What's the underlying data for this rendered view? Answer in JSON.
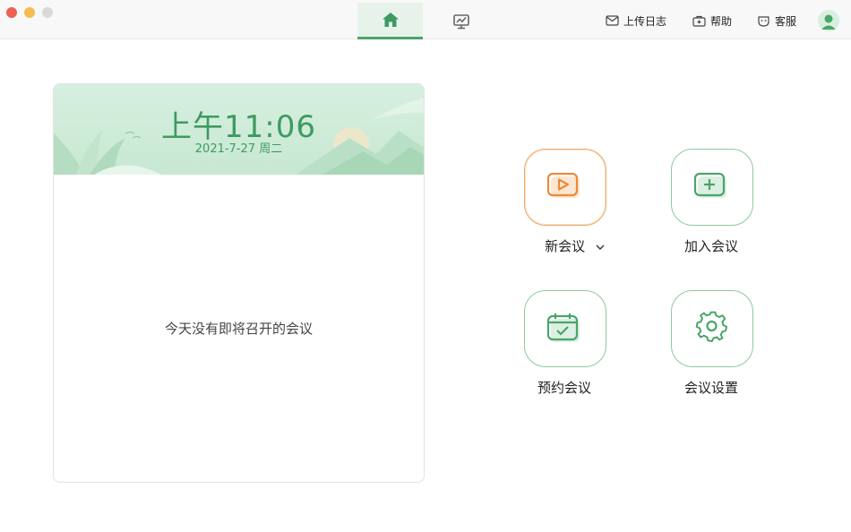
{
  "toolbar": {
    "upload_log": "上传日志",
    "help": "帮助",
    "support": "客服"
  },
  "tabs": [
    {
      "name": "home",
      "icon": "home-icon",
      "active": true
    },
    {
      "name": "stats",
      "icon": "chart-icon",
      "active": false
    }
  ],
  "meeting_card": {
    "time": "上午11:06",
    "date": "2021-7-27 周二",
    "empty_message": "今天没有即将召开的会议"
  },
  "actions": {
    "new_meeting": "新会议",
    "join_meeting": "加入会议",
    "schedule_meeting": "预约会议",
    "meeting_settings": "会议设置"
  },
  "colors": {
    "accent_green": "#4aa56a",
    "accent_orange": "#ec8a3a"
  }
}
